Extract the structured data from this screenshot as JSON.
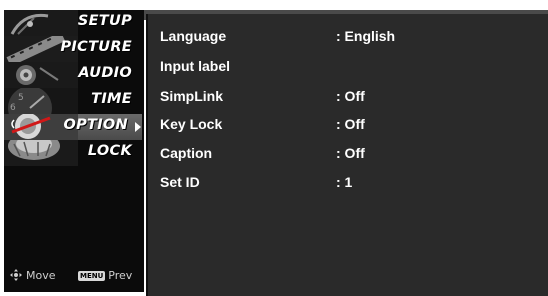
{
  "menu": {
    "items": [
      {
        "label": "SETUP",
        "selected": false
      },
      {
        "label": "PICTURE",
        "selected": false
      },
      {
        "label": "AUDIO",
        "selected": false
      },
      {
        "label": "TIME",
        "selected": false
      },
      {
        "label": "OPTION",
        "selected": true
      },
      {
        "label": "LOCK",
        "selected": false
      }
    ],
    "hints": {
      "move_label": "Move",
      "menu_key_label": "MENU",
      "prev_label": "Prev"
    }
  },
  "options": {
    "rows": [
      {
        "label": "Language",
        "value": ": English"
      },
      {
        "label": "Input label",
        "value": ""
      },
      {
        "label": "SimpLink",
        "value": ": Off"
      },
      {
        "label": "Key Lock",
        "value": ": Off"
      },
      {
        "label": "Caption",
        "value": ": Off"
      },
      {
        "label": "Set ID",
        "value": ": 1"
      }
    ]
  },
  "colors": {
    "sidebar_bg": "#0b0b0b",
    "panel_bg": "#2a2a2a",
    "highlight": "#5a5a5a",
    "text": "#ffffff"
  }
}
